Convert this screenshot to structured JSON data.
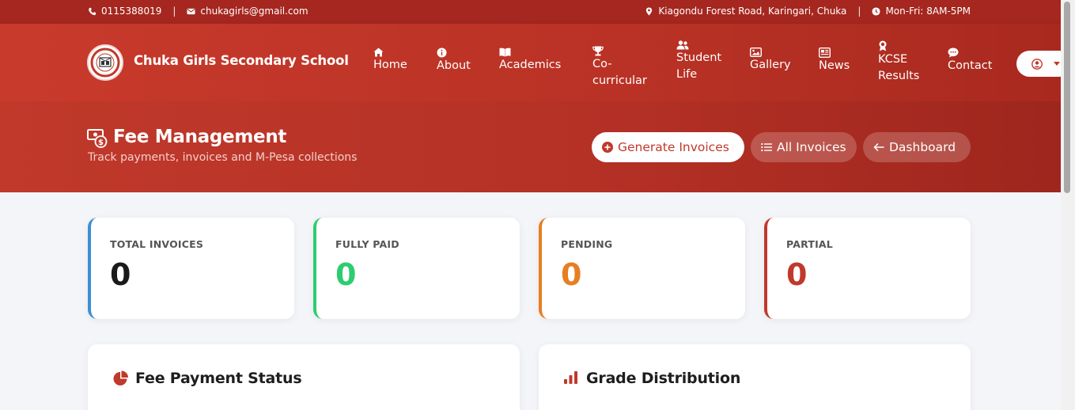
{
  "topbar": {
    "phone": "0115388019",
    "email": "chukagirls@gmail.com",
    "address": "Kiagondu Forest Road, Karingari, Chuka",
    "hours": "Mon-Fri: 8AM-5PM"
  },
  "header": {
    "school_name": "Chuka Girls Secondary School",
    "nav": [
      {
        "label": "Home",
        "icon": "home-icon"
      },
      {
        "label": "About",
        "icon": "info-icon"
      },
      {
        "label": "Academics",
        "icon": "book-icon"
      },
      {
        "label_line1": "Co-",
        "label_line2": "curricular",
        "icon": "trophy-icon"
      },
      {
        "label_line1": "Student",
        "label_line2": "Life",
        "icon": "users-icon"
      },
      {
        "label": "Gallery",
        "icon": "image-icon"
      },
      {
        "label": "News",
        "icon": "newspaper-icon"
      },
      {
        "label_line1": "KCSE",
        "label_line2": "Results",
        "icon": "award-icon"
      },
      {
        "label": "Contact",
        "icon": "chat-icon"
      }
    ]
  },
  "hero": {
    "title": "Fee Management",
    "subtitle": "Track payments, invoices and M-Pesa collections",
    "buttons": {
      "generate": "Generate Invoices",
      "all": "All Invoices",
      "dashboard": "Dashboard"
    }
  },
  "stats": [
    {
      "label": "TOTAL INVOICES",
      "value": "0",
      "color": "#3a8fd6"
    },
    {
      "label": "FULLY PAID",
      "value": "0",
      "color": "#2ecc71"
    },
    {
      "label": "PENDING",
      "value": "0",
      "color": "#e67e22"
    },
    {
      "label": "PARTIAL",
      "value": "0",
      "color": "#c0392b"
    }
  ],
  "panels": {
    "fee_status": "Fee Payment Status",
    "grade_distribution": "Grade Distribution"
  },
  "colors": {
    "brand": "#c0392b",
    "brand_dark": "#a5271f",
    "background": "#f4f5f8"
  }
}
